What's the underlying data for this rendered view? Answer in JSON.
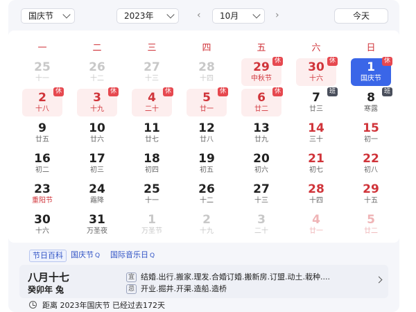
{
  "header": {
    "year_label": "国庆节",
    "year_select": "2023年",
    "month_select": "10月",
    "prev": "‹",
    "next": "›",
    "today_button": "今天"
  },
  "weekdays": [
    "一",
    "二",
    "三",
    "四",
    "五",
    "六",
    "日"
  ],
  "days": [
    {
      "n": "25",
      "l": "十一",
      "muted": true
    },
    {
      "n": "26",
      "l": "十二",
      "muted": true
    },
    {
      "n": "27",
      "l": "十三",
      "muted": true
    },
    {
      "n": "28",
      "l": "十四",
      "muted": true
    },
    {
      "n": "29",
      "l": "中秋节",
      "muted": true,
      "hol": true,
      "holiday": true,
      "badge": "休"
    },
    {
      "n": "30",
      "l": "十六",
      "muted": true,
      "hol": true,
      "holiday": true,
      "badge": "休"
    },
    {
      "n": "1",
      "l": "国庆节",
      "selected": true,
      "badge": "休"
    },
    {
      "n": "2",
      "l": "十八",
      "holiday": true,
      "badge": "休"
    },
    {
      "n": "3",
      "l": "十九",
      "holiday": true,
      "badge": "休"
    },
    {
      "n": "4",
      "l": "二十",
      "holiday": true,
      "badge": "休"
    },
    {
      "n": "5",
      "l": "廿一",
      "holiday": true,
      "badge": "休"
    },
    {
      "n": "6",
      "l": "廿二",
      "holiday": true,
      "badge": "休"
    },
    {
      "n": "7",
      "l": "廿三",
      "badge": "班",
      "work": true
    },
    {
      "n": "8",
      "l": "寒露",
      "badge": "班",
      "work": true
    },
    {
      "n": "9",
      "l": "廿五"
    },
    {
      "n": "10",
      "l": "廿六"
    },
    {
      "n": "11",
      "l": "廿七"
    },
    {
      "n": "12",
      "l": "廿八"
    },
    {
      "n": "13",
      "l": "廿九"
    },
    {
      "n": "14",
      "l": "三十",
      "weekend": true
    },
    {
      "n": "15",
      "l": "初一",
      "weekend": true
    },
    {
      "n": "16",
      "l": "初二"
    },
    {
      "n": "17",
      "l": "初三"
    },
    {
      "n": "18",
      "l": "初四"
    },
    {
      "n": "19",
      "l": "初五"
    },
    {
      "n": "20",
      "l": "初六"
    },
    {
      "n": "21",
      "l": "初七",
      "weekend": true
    },
    {
      "n": "22",
      "l": "初八",
      "weekend": true
    },
    {
      "n": "23",
      "l": "重阳节",
      "festival": true
    },
    {
      "n": "24",
      "l": "霜降"
    },
    {
      "n": "25",
      "l": "十一"
    },
    {
      "n": "26",
      "l": "十二"
    },
    {
      "n": "27",
      "l": "十三"
    },
    {
      "n": "28",
      "l": "十四",
      "weekend": true
    },
    {
      "n": "29",
      "l": "十五",
      "weekend": true
    },
    {
      "n": "30",
      "l": "十六"
    },
    {
      "n": "31",
      "l": "万圣夜"
    },
    {
      "n": "1",
      "l": "万圣节",
      "muted": true
    },
    {
      "n": "2",
      "l": "十九",
      "muted": true
    },
    {
      "n": "3",
      "l": "二十",
      "muted": true
    },
    {
      "n": "4",
      "l": "廿一",
      "muted": true,
      "weekend": true
    },
    {
      "n": "5",
      "l": "廿二",
      "muted": true,
      "weekend": true
    }
  ],
  "tags": {
    "encyclopedia": "节日百科",
    "national_day": "国庆节",
    "music_day": "国际音乐日",
    "q": "Q"
  },
  "almanac": {
    "lunar_date": "八月十七",
    "ganzhi": "癸卯年 兔",
    "yi_mark": "宜",
    "yi": "结婚.出行.搬家.理发.合婚订婚.搬新房.订盟.动土.栽种....",
    "ji_mark": "忌",
    "ji": "开业.掘井.开渠.造船.造桥"
  },
  "countdown": "距离 2023年国庆节 已经过去172天"
}
